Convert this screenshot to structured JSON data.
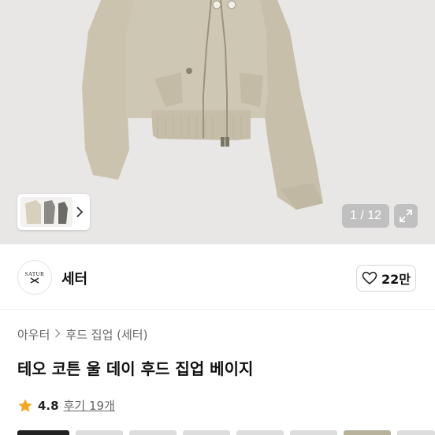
{
  "gallery": {
    "counter": "1 / 12",
    "thumb_icon": "chevron-right-icon",
    "expand_icon": "expand-icon"
  },
  "shop": {
    "logo_text_top": "SATUR",
    "name": "세터",
    "like_count": "22만",
    "like_icon": "heart-outline-icon"
  },
  "breadcrumb": {
    "items": [
      "아우터",
      "후드 집업 (세터)"
    ]
  },
  "product": {
    "title": "테오 코튼 울 데이 후드 집업 베이지"
  },
  "rating": {
    "value": "4.8",
    "review_link": "후기 19개",
    "star_color": "#f5a623"
  },
  "colors": {
    "jacket": "#c9c1ac",
    "background": "#e9e7e6"
  }
}
